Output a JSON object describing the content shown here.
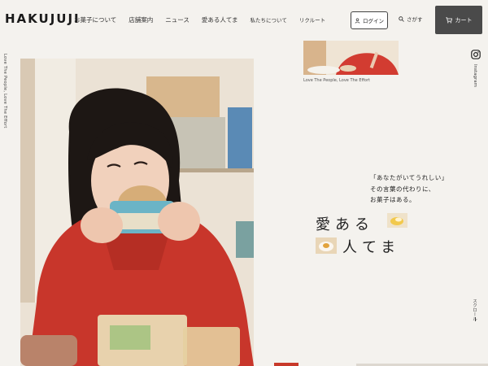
{
  "header": {
    "logo": "HAKUJUJI",
    "nav": [
      "お菓子について",
      "店舗案内",
      "ニュース",
      "愛ある人てま",
      "私たちについて",
      "リクルート"
    ],
    "login_label": "ログイン",
    "search_label": "さがす",
    "cart_label": "カート"
  },
  "side": {
    "left_text": "Love The People, Love The Effort",
    "instagram_label": "Instagram",
    "scroll_label": "スクロール"
  },
  "thumb": {
    "caption": "Love The People, Love The Effort"
  },
  "copy": {
    "quote_lines": [
      "「あなたがいてうれしい」",
      "その言葉の代わりに、",
      "お菓子はある。"
    ],
    "title_row1": "愛ある",
    "title_row2": "人てま"
  },
  "colors": {
    "background": "#f4f2ee",
    "cart_bg": "#4a4a4a",
    "accent_red": "#c8392a"
  }
}
